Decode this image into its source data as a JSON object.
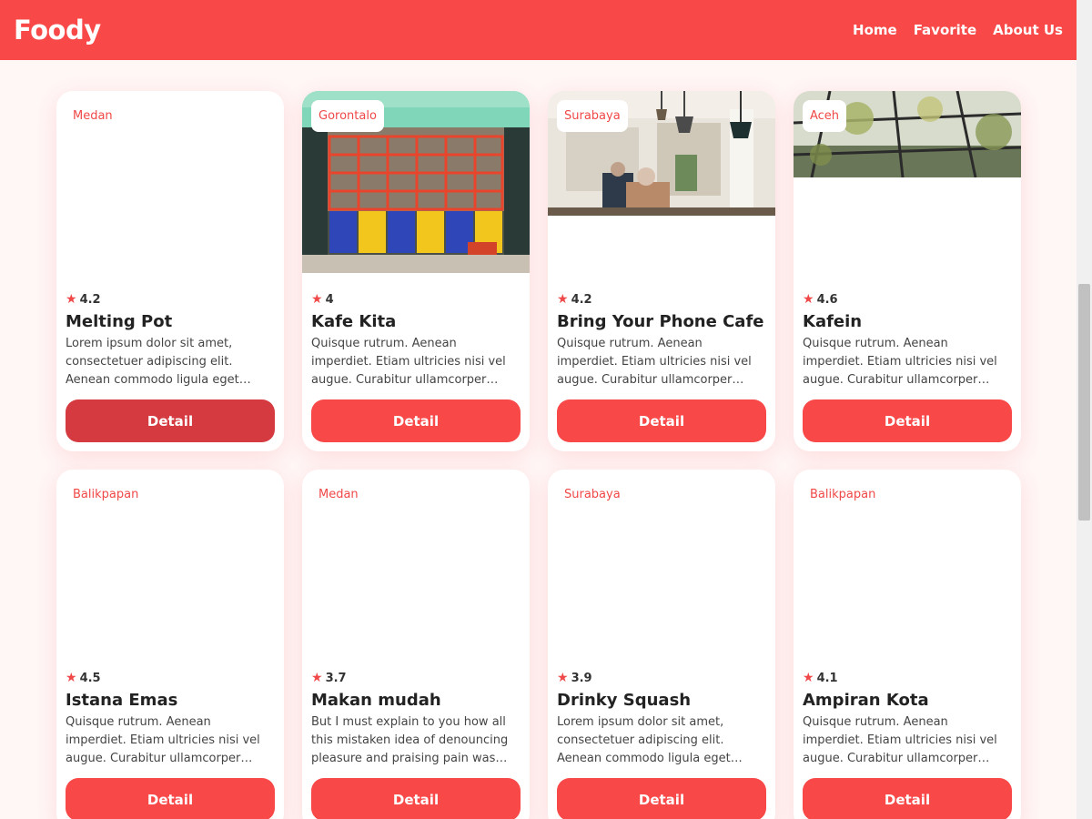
{
  "app": {
    "brand": "Foody"
  },
  "nav": {
    "items": [
      "Home",
      "Favorite",
      "About Us"
    ]
  },
  "restaurants": [
    {
      "city": "Medan",
      "rating": "4.2",
      "name": "Melting Pot",
      "description": "Lorem ipsum dolor sit amet, consectetuer adipiscing elit. Aenean commodo ligula eget dolor.",
      "button": "Detail",
      "image": "none"
    },
    {
      "city": "Gorontalo",
      "rating": "4",
      "name": "Kafe Kita",
      "description": "Quisque rutrum. Aenean imperdiet. Etiam ultricies nisi vel augue. Curabitur ullamcorper ultricies nisi.",
      "button": "Detail",
      "image": "storefront"
    },
    {
      "city": "Surabaya",
      "rating": "4.2",
      "name": "Bring Your Phone Cafe",
      "description": "Quisque rutrum. Aenean imperdiet. Etiam ultricies nisi vel augue. Curabitur ullamcorper ultricies nisi.",
      "button": "Detail",
      "image": "cafe-interior"
    },
    {
      "city": "Aceh",
      "rating": "4.6",
      "name": "Kafein",
      "description": "Quisque rutrum. Aenean imperdiet. Etiam ultricies nisi vel augue. Curabitur ullamcorper ultricies nisi.",
      "button": "Detail",
      "image": "greenhouse"
    },
    {
      "city": "Balikpapan",
      "rating": "4.5",
      "name": "Istana Emas",
      "description": "Quisque rutrum. Aenean imperdiet. Etiam ultricies nisi vel augue. Curabitur ullamcorper ultricies nisi.",
      "button": "Detail",
      "image": "none"
    },
    {
      "city": "Medan",
      "rating": "3.7",
      "name": "Makan mudah",
      "description": "But I must explain to you how all this mistaken idea of denouncing pleasure and praising pain was born.",
      "button": "Detail",
      "image": "none"
    },
    {
      "city": "Surabaya",
      "rating": "3.9",
      "name": "Drinky Squash",
      "description": "Lorem ipsum dolor sit amet, consectetuer adipiscing elit. Aenean commodo ligula eget dolor.",
      "button": "Detail",
      "image": "none"
    },
    {
      "city": "Balikpapan",
      "rating": "4.1",
      "name": "Ampiran Kota",
      "description": "Quisque rutrum. Aenean imperdiet. Etiam ultricies nisi vel augue. Curabitur ullamcorper ultricies nisi.",
      "button": "Detail",
      "image": "none"
    }
  ],
  "colors": {
    "primary": "#f84848",
    "primary_hover": "#d43a3f",
    "background": "#fff6f6"
  }
}
